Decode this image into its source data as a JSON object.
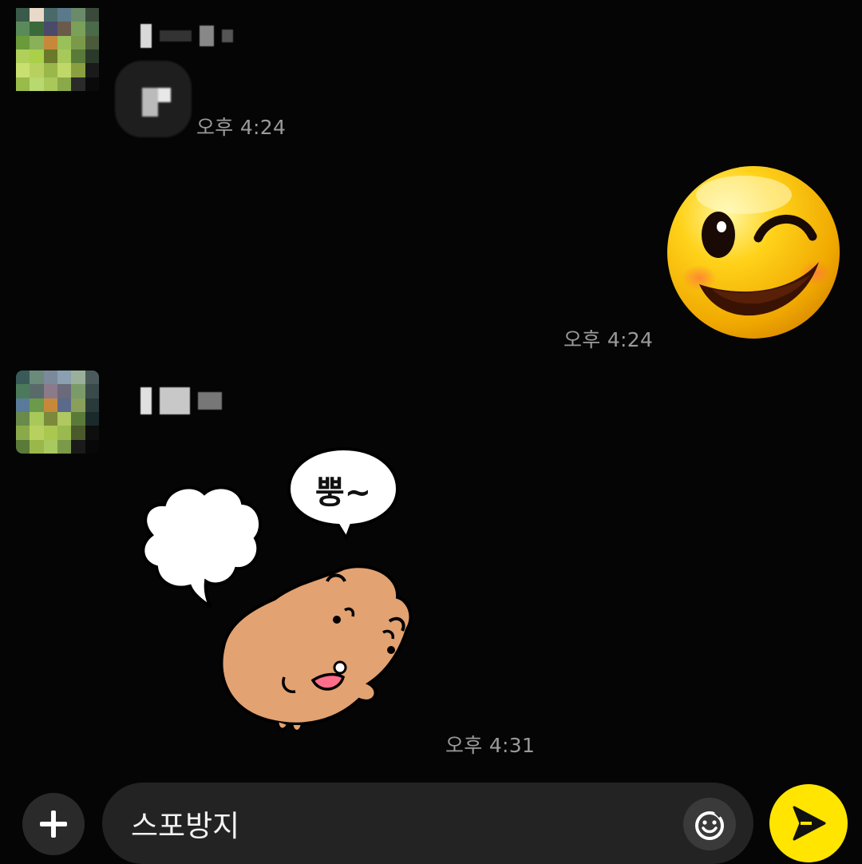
{
  "messages": [
    {
      "sender": "other",
      "type": "text",
      "time": "오후 4:24"
    },
    {
      "sender": "me",
      "type": "emoji",
      "emoji": "wink-face",
      "time": "오후 4:24"
    },
    {
      "sender": "other",
      "type": "sticker",
      "sticker_text": "뿡~",
      "time": "오후 4:31"
    }
  ],
  "input": {
    "value": "스포방지"
  },
  "icons": {
    "attach": "plus-icon",
    "emoji": "smiley-icon",
    "send": "send-arrow-icon"
  },
  "colors": {
    "background": "#050505",
    "send_button": "#ffe500",
    "timestamp": "#9a9a9a"
  }
}
